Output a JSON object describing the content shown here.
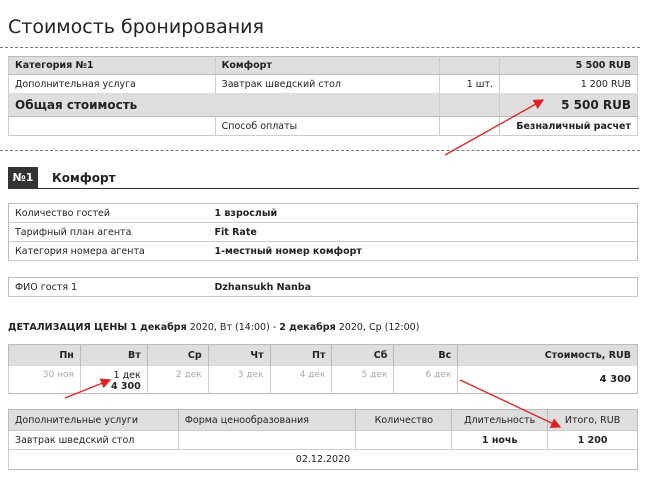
{
  "page_title": "Стоимость бронирования",
  "summary": {
    "category_label": "Категория №1",
    "category_value": "Комфорт",
    "category_price": "5 500 RUB",
    "service_label": "Дополнительная услуга",
    "service_name": "Завтрак шведский стол",
    "service_qty": "1 шт.",
    "service_price": "1 200 RUB",
    "total_label": "Общая стоимость",
    "total_value": "5 500 RUB",
    "payment_label": "Способ оплаты",
    "payment_value": "Безналичный расчет"
  },
  "room": {
    "number": "№1",
    "name": "Комфорт"
  },
  "room_info": [
    {
      "key": "Количество гостей",
      "value": "1 взрослый"
    },
    {
      "key": "Тарифный план агента",
      "value": "Fit Rate"
    },
    {
      "key": "Категория номера агента",
      "value": "1-местный номер комфорт"
    }
  ],
  "guest": {
    "key": "ФИО гостя 1",
    "value": "Dzhansukh Nanba"
  },
  "detail": {
    "label": "ДЕТАЛИЗАЦИЯ ЦЕНЫ",
    "from_date": "1 декабря",
    "from_rest": "2020, Вт (14:00)",
    "sep": " - ",
    "to_date": "2 декабря",
    "to_rest": "2020, Ср (12:00)"
  },
  "days_table": {
    "headers": [
      "Пн",
      "Вт",
      "Ср",
      "Чт",
      "Пт",
      "Сб",
      "Вс",
      "Стоимость, RUB"
    ],
    "cells": [
      "30 ноя",
      "1 дек",
      "2 дек",
      "3 дек",
      "4 дек",
      "5 дек",
      "6 дек"
    ],
    "active_price": "4 300",
    "total": "4 300"
  },
  "extras_table": {
    "headers": [
      "Дополнительные услуги",
      "Форма ценообразования",
      "Количество",
      "Длительность",
      "Итого, RUB"
    ],
    "row": {
      "name": "Завтрак шведский стол",
      "pricing": "",
      "qty": "",
      "duration": "1 ночь",
      "total": "1 200"
    },
    "date": "02.12.2020"
  },
  "colors": {
    "annotation_arrow": "#e02020",
    "header_bg": "#dedede",
    "room_badge": "#333333"
  }
}
